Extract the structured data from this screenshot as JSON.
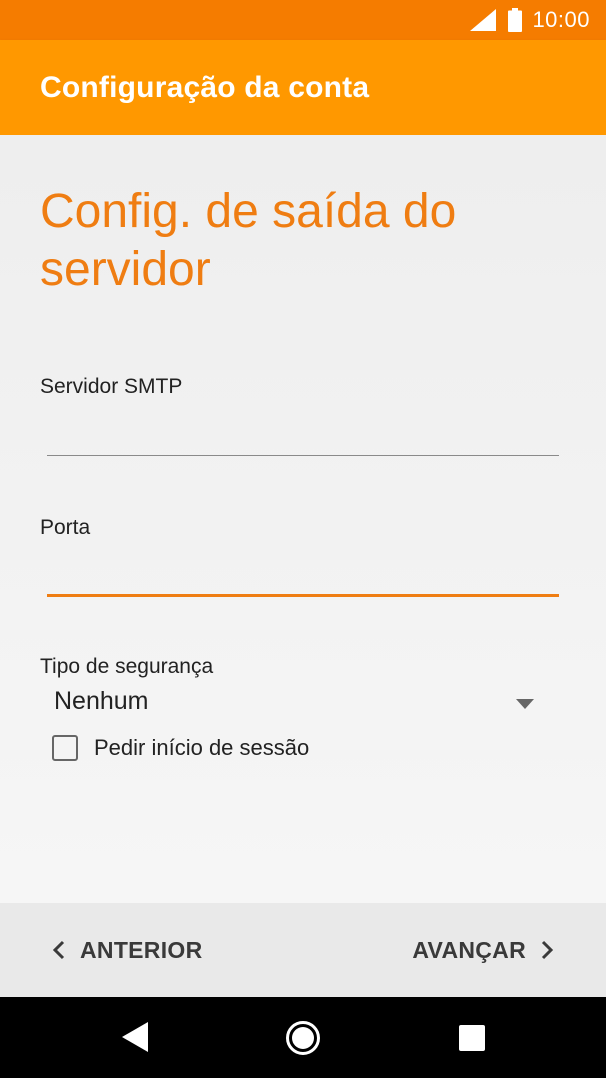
{
  "status_bar": {
    "time": "10:00",
    "icons": [
      "signal-icon",
      "battery-icon"
    ]
  },
  "app_bar": {
    "title": "Configuração da conta"
  },
  "page": {
    "heading": "Config. de saída do servidor",
    "smtp_server": {
      "label": "Servidor SMTP",
      "value": ""
    },
    "port": {
      "label": "Porta",
      "value": ""
    },
    "security": {
      "label": "Tipo de segurança",
      "selected": "Nenhum"
    },
    "require_signin": {
      "label": "Pedir início de sessão",
      "checked": false
    }
  },
  "footer": {
    "prev_label": "ANTERIOR",
    "next_label": "AVANÇAR"
  },
  "nav_bar": {
    "icons": [
      "back-icon",
      "home-icon",
      "recents-icon"
    ]
  },
  "colors": {
    "status_bar": "#f57c00",
    "app_bar": "#ff9800",
    "accent": "#ef7d12"
  }
}
